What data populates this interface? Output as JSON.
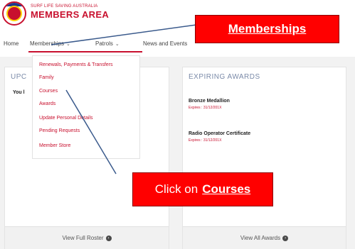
{
  "header": {
    "org_name": "SURF LIFE SAVING AUSTRALIA",
    "app_title": "MEMBERS AREA"
  },
  "nav": {
    "home": "Home",
    "memberships": "Memberships",
    "patrols": "Patrols",
    "news": "News and Events",
    "chevron": "⌄"
  },
  "dropdown": {
    "items": [
      "Renewals, Payments & Transfers",
      "Family",
      "Courses",
      "Awards",
      "Update Personal Details",
      "Pending Requests",
      "Member Store"
    ]
  },
  "panels": {
    "left": {
      "title": "UPC",
      "text": "You l",
      "footer": "View Full Roster"
    },
    "right": {
      "title": "EXPIRING AWARDS",
      "awards": [
        {
          "name": "Bronze Medallion",
          "expiry": "Expires : 31/12/201X"
        },
        {
          "name": "Radio Operator Certificate",
          "expiry": "Expires : 31/12/201X"
        }
      ],
      "footer": "View All Awards"
    },
    "footer_icon": "›"
  },
  "callouts": {
    "memberships": "Memberships",
    "courses_prefix": "Click on",
    "courses_bold": "Courses"
  },
  "colors": {
    "brand_red": "#c8102e",
    "callout_red": "#ff0000",
    "arrow_blue": "#3a5a8c"
  }
}
